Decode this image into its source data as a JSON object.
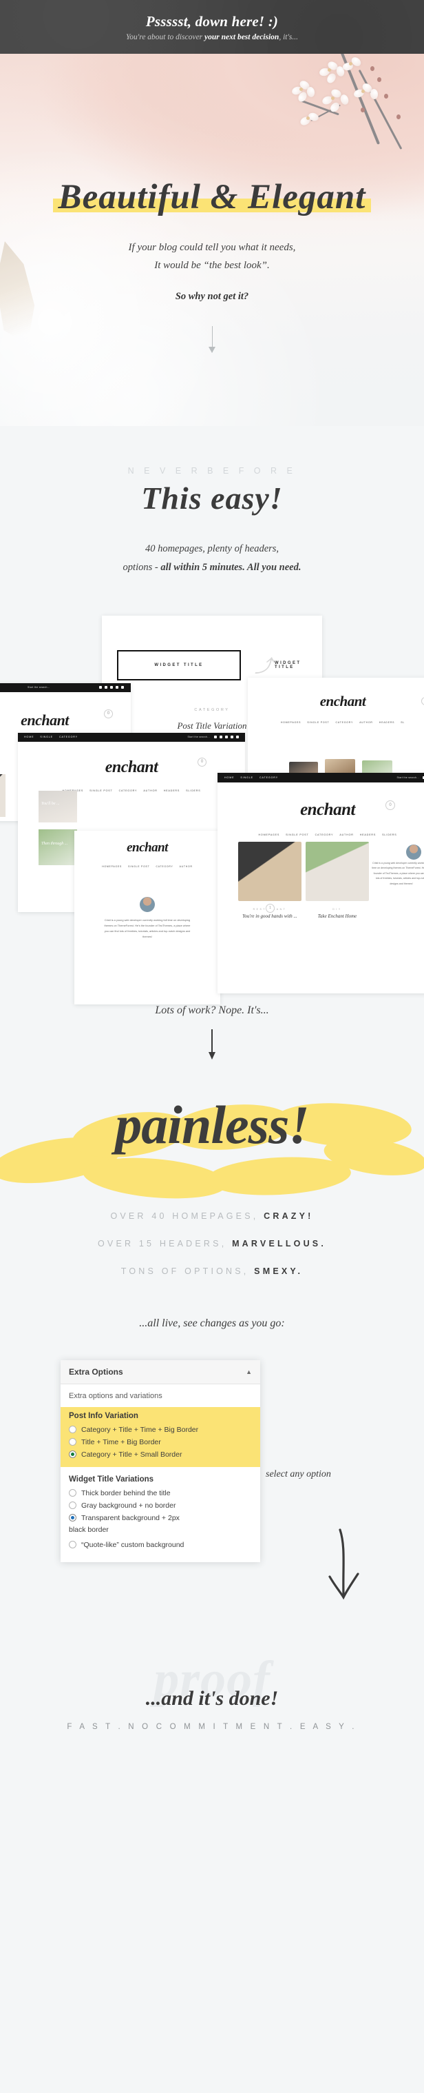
{
  "topbar": {
    "title": "Pssssst, down here! :)",
    "sub_pre": "You're about to discover ",
    "sub_bold": "your next best decision",
    "sub_post": ", it's..."
  },
  "hero": {
    "headline": "Beautiful  &  Elegant",
    "line1": "If your blog could tell you what it needs,",
    "line2": "It would be “the best look”.",
    "question": "So why not get it?",
    "arrow_icon": "arrow-down-icon"
  },
  "easy": {
    "eyebrow": "N E V E R   B E F O R E",
    "headline": "This  easy!",
    "copy_line1": "40 homepages, plenty of headers,",
    "copy_line2_pre": "options - ",
    "copy_line2_bold": "all within 5 minutes. All you need."
  },
  "collage": {
    "widget_title_boxed": "WIDGET TITLE",
    "widget_title_swash": "WIDGET TITLE",
    "category_label": "CATEGORY",
    "post_title_variation": "Post Title Variation",
    "logo": "enchant",
    "nav_items": [
      "HOMEPAGES",
      "SINGLE POST",
      "CATEGORY",
      "AUTHOR",
      "HEADERS",
      "SLIDERS"
    ],
    "nav_items_short": [
      "HOME",
      "SINGLE",
      "CATEGORY"
    ],
    "search_placeholder": "Start the search...",
    "bio": "Cristi is a young web developer currently working full time on developing themes on ThemeForest. He's the founder of TeoThemes, a place where you can find lots of freebies, tutorials, articles and top-notch designs and themes!",
    "card1_title": "You're in good hands with ...",
    "card2_title": "Take Enchant Home",
    "card1_meta": "RESTAURANT",
    "card2_meta": "DIY",
    "overlay1": "You'll be ...",
    "overlay2": "Then through ..."
  },
  "painless": {
    "lead": "Lots of work? Nope. It's...",
    "arrow_icon": "arrow-down-icon",
    "word": "painless!"
  },
  "features": [
    {
      "muted": "OVER 40 HOMEPAGES,",
      "bold": "CRAZY!"
    },
    {
      "muted": "OVER 15 HEADERS,",
      "bold": "MARVELLOUS."
    },
    {
      "muted": "TONS OF OPTIONS,",
      "bold": "SMEXY."
    }
  ],
  "live": {
    "headline": "...all live, see changes as you go:",
    "panel": {
      "title": "Extra Options",
      "collapse_icon": "caret-up-icon",
      "subtitle": "Extra options and variations",
      "group1_title": "Post Info Variation",
      "group1_options": [
        {
          "label": "Category + Title + Time + Big Border",
          "selected": false
        },
        {
          "label": "Title + Time + Big Border",
          "selected": false
        },
        {
          "label": "Category + Title + Small Border",
          "selected": true
        }
      ],
      "group2_title": "Widget Title Variations",
      "group2_options": [
        {
          "label": "Thick border behind the title",
          "selected": false
        },
        {
          "label": "Gray background + no border",
          "selected": false
        },
        {
          "label": "Transparent background + 2px",
          "selected": true
        },
        {
          "label": "“Quote-like” custom background",
          "selected": false
        }
      ],
      "group2_note": "black border"
    },
    "annotation": "select any option",
    "arrow_icon": "hand-drawn-arrow-down-icon"
  },
  "done": {
    "watermark": "proof",
    "headline": "...and it's done!",
    "sub": "F A S T .   N O   C O M M I T M E N T .   E A S Y ."
  },
  "colors": {
    "accent_yellow": "#fbe375",
    "dark": "#3d3d3d",
    "topbar": "#464646",
    "page_bg": "#f4f6f7",
    "muted": "#b7bbbe"
  }
}
